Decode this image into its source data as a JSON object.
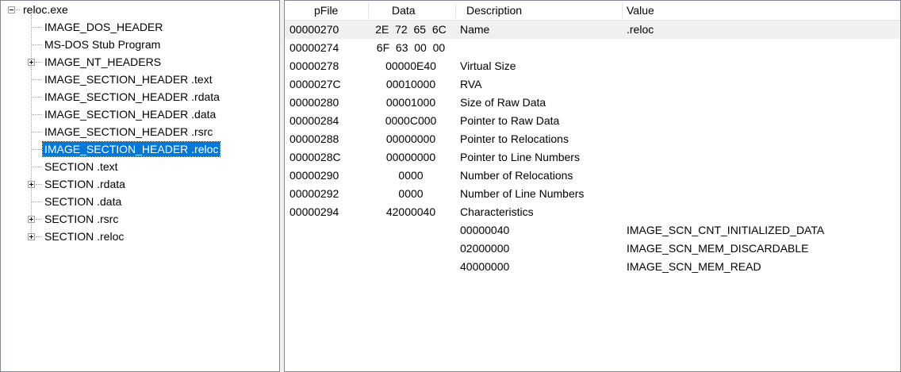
{
  "tree": {
    "root": "reloc.exe",
    "items": [
      {
        "label": "IMAGE_DOS_HEADER",
        "expandable": false
      },
      {
        "label": "MS-DOS Stub Program",
        "expandable": false
      },
      {
        "label": "IMAGE_NT_HEADERS",
        "expandable": true
      },
      {
        "label": "IMAGE_SECTION_HEADER .text",
        "expandable": false
      },
      {
        "label": "IMAGE_SECTION_HEADER .rdata",
        "expandable": false
      },
      {
        "label": "IMAGE_SECTION_HEADER .data",
        "expandable": false
      },
      {
        "label": "IMAGE_SECTION_HEADER .rsrc",
        "expandable": false
      },
      {
        "label": "IMAGE_SECTION_HEADER .reloc",
        "expandable": false,
        "selected": true
      },
      {
        "label": "SECTION .text",
        "expandable": false
      },
      {
        "label": "SECTION .rdata",
        "expandable": true
      },
      {
        "label": "SECTION .data",
        "expandable": false
      },
      {
        "label": "SECTION .rsrc",
        "expandable": true
      },
      {
        "label": "SECTION .reloc",
        "expandable": true
      }
    ]
  },
  "list": {
    "columns": [
      "pFile",
      "Data",
      "Description",
      "Value"
    ],
    "rows": [
      {
        "pfile": "00000270",
        "data": "2E  72  65  6C",
        "description": "Name",
        "value": ".reloc"
      },
      {
        "pfile": "00000274",
        "data": "6F  63  00  00",
        "description": "",
        "value": ""
      },
      {
        "pfile": "00000278",
        "data": "00000E40",
        "description": "Virtual Size",
        "value": ""
      },
      {
        "pfile": "0000027C",
        "data": "00010000",
        "description": "RVA",
        "value": ""
      },
      {
        "pfile": "00000280",
        "data": "00001000",
        "description": "Size of Raw Data",
        "value": ""
      },
      {
        "pfile": "00000284",
        "data": "0000C000",
        "description": "Pointer to Raw Data",
        "value": ""
      },
      {
        "pfile": "00000288",
        "data": "00000000",
        "description": "Pointer to Relocations",
        "value": ""
      },
      {
        "pfile": "0000028C",
        "data": "00000000",
        "description": "Pointer to Line Numbers",
        "value": ""
      },
      {
        "pfile": "00000290",
        "data": "0000",
        "description": "Number of Relocations",
        "value": ""
      },
      {
        "pfile": "00000292",
        "data": "0000",
        "description": "Number of Line Numbers",
        "value": ""
      },
      {
        "pfile": "00000294",
        "data": "42000040",
        "description": "Characteristics",
        "value": ""
      },
      {
        "pfile": "",
        "data": "",
        "description": "00000040",
        "value": "IMAGE_SCN_CNT_INITIALIZED_DATA"
      },
      {
        "pfile": "",
        "data": "",
        "description": "02000000",
        "value": "IMAGE_SCN_MEM_DISCARDABLE"
      },
      {
        "pfile": "",
        "data": "",
        "description": "40000000",
        "value": "IMAGE_SCN_MEM_READ"
      }
    ]
  },
  "colors": {
    "selection": "#0078d7",
    "row_highlight": "#f0f0f0"
  }
}
